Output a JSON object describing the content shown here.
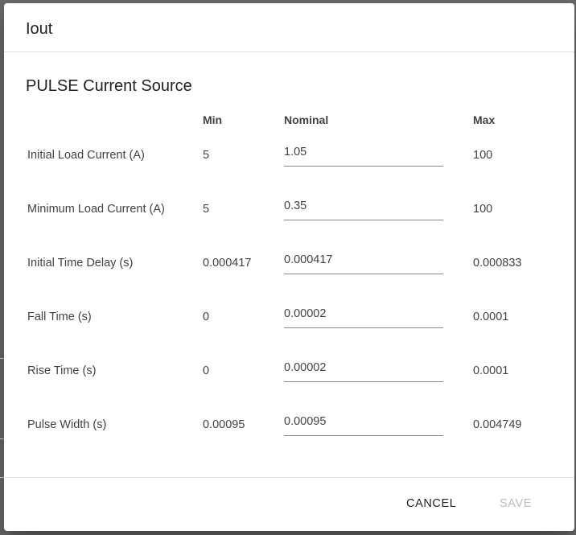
{
  "dialog": {
    "title": "Iout",
    "section_title": "PULSE Current Source"
  },
  "columns": {
    "min": "Min",
    "nominal": "Nominal",
    "max": "Max"
  },
  "rows": [
    {
      "label": "Initial Load Current (A)",
      "min": "5",
      "nominal": "1.05",
      "max": "100"
    },
    {
      "label": "Minimum Load Current (A)",
      "min": "5",
      "nominal": "0.35",
      "max": "100"
    },
    {
      "label": "Initial Time Delay (s)",
      "min": "0.000417",
      "nominal": "0.000417",
      "max": "0.000833"
    },
    {
      "label": "Fall Time (s)",
      "min": "0",
      "nominal": "0.00002",
      "max": "0.0001"
    },
    {
      "label": "Rise Time (s)",
      "min": "0",
      "nominal": "0.00002",
      "max": "0.0001"
    },
    {
      "label": "Pulse Width (s)",
      "min": "0.00095",
      "nominal": "0.00095",
      "max": "0.004749"
    }
  ],
  "actions": {
    "cancel_label": "CANCEL",
    "save_label": "SAVE",
    "save_enabled": false
  }
}
